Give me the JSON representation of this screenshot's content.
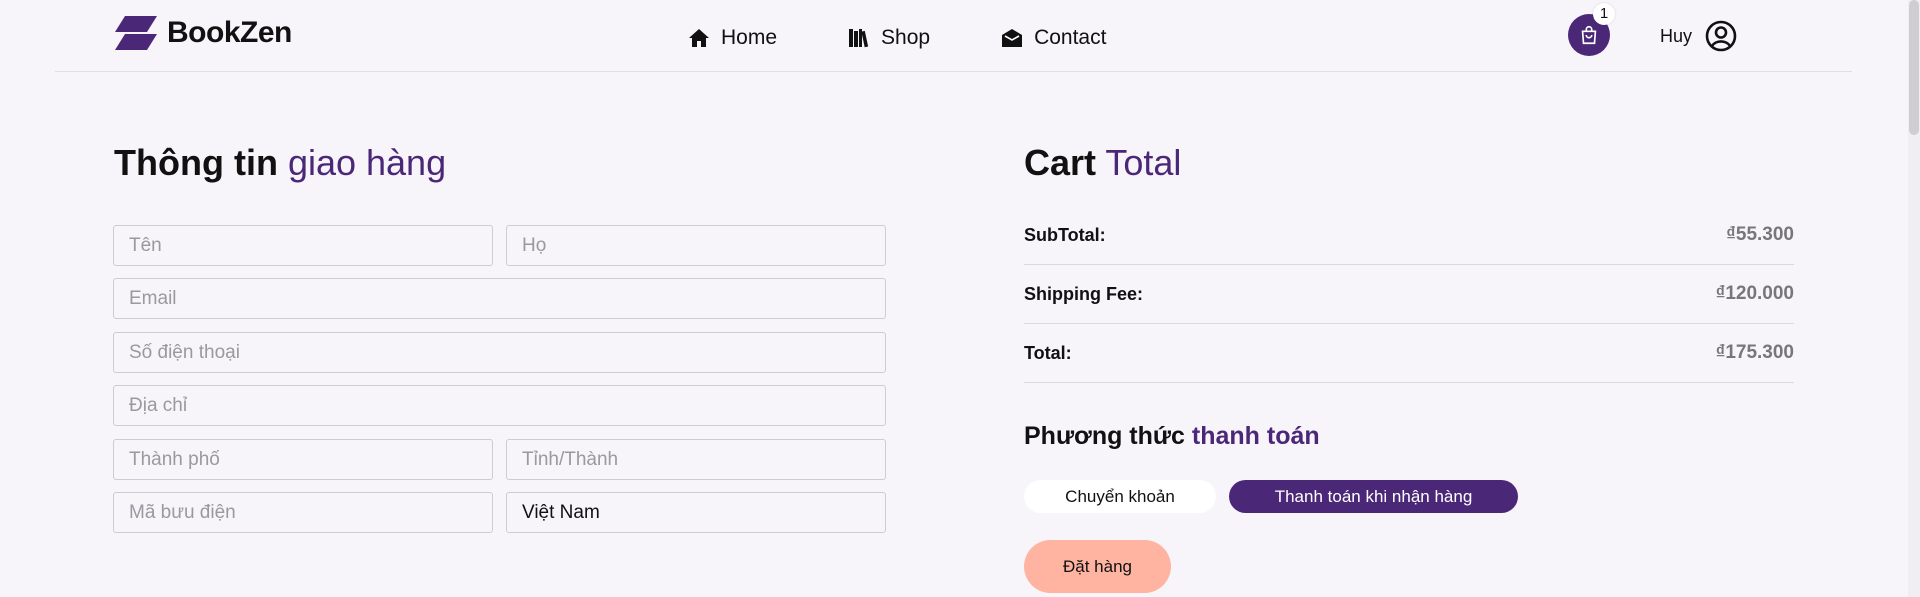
{
  "brand": {
    "name": "BookZen"
  },
  "nav": [
    {
      "label": "Home",
      "icon": "home-icon"
    },
    {
      "label": "Shop",
      "icon": "books-icon"
    },
    {
      "label": "Contact",
      "icon": "envelope-icon"
    }
  ],
  "cart": {
    "count": "1"
  },
  "user": {
    "name": "Huy"
  },
  "shipping_form": {
    "title_bold": "Thông tin",
    "title_light": "giao hàng",
    "first_name_placeholder": "Tên",
    "last_name_placeholder": "Họ",
    "email_placeholder": "Email",
    "phone_placeholder": "Số điện thoại",
    "address_placeholder": "Địa chỉ",
    "city_placeholder": "Thành phố",
    "province_placeholder": "Tỉnh/Thành",
    "postal_placeholder": "Mã bưu điện",
    "country_value": "Việt Nam"
  },
  "cart_total": {
    "title_bold": "Cart",
    "title_light": "Total",
    "rows": [
      {
        "label": "SubTotal:",
        "value": "₫55.300"
      },
      {
        "label": "Shipping Fee:",
        "value": "₫120.000"
      },
      {
        "label": "Total:",
        "value": "₫175.300"
      }
    ]
  },
  "payment": {
    "title_bold": "Phương thức",
    "title_light": "thanh toán",
    "options": [
      {
        "label": "Chuyển khoản",
        "selected": false
      },
      {
        "label": "Thanh toán khi nhận hàng",
        "selected": true
      }
    ]
  },
  "order_button": {
    "label": "Đặt hàng"
  },
  "colors": {
    "accent": "#4b2778",
    "order_button": "#ffb4a2",
    "background": "#f7f4fa"
  }
}
